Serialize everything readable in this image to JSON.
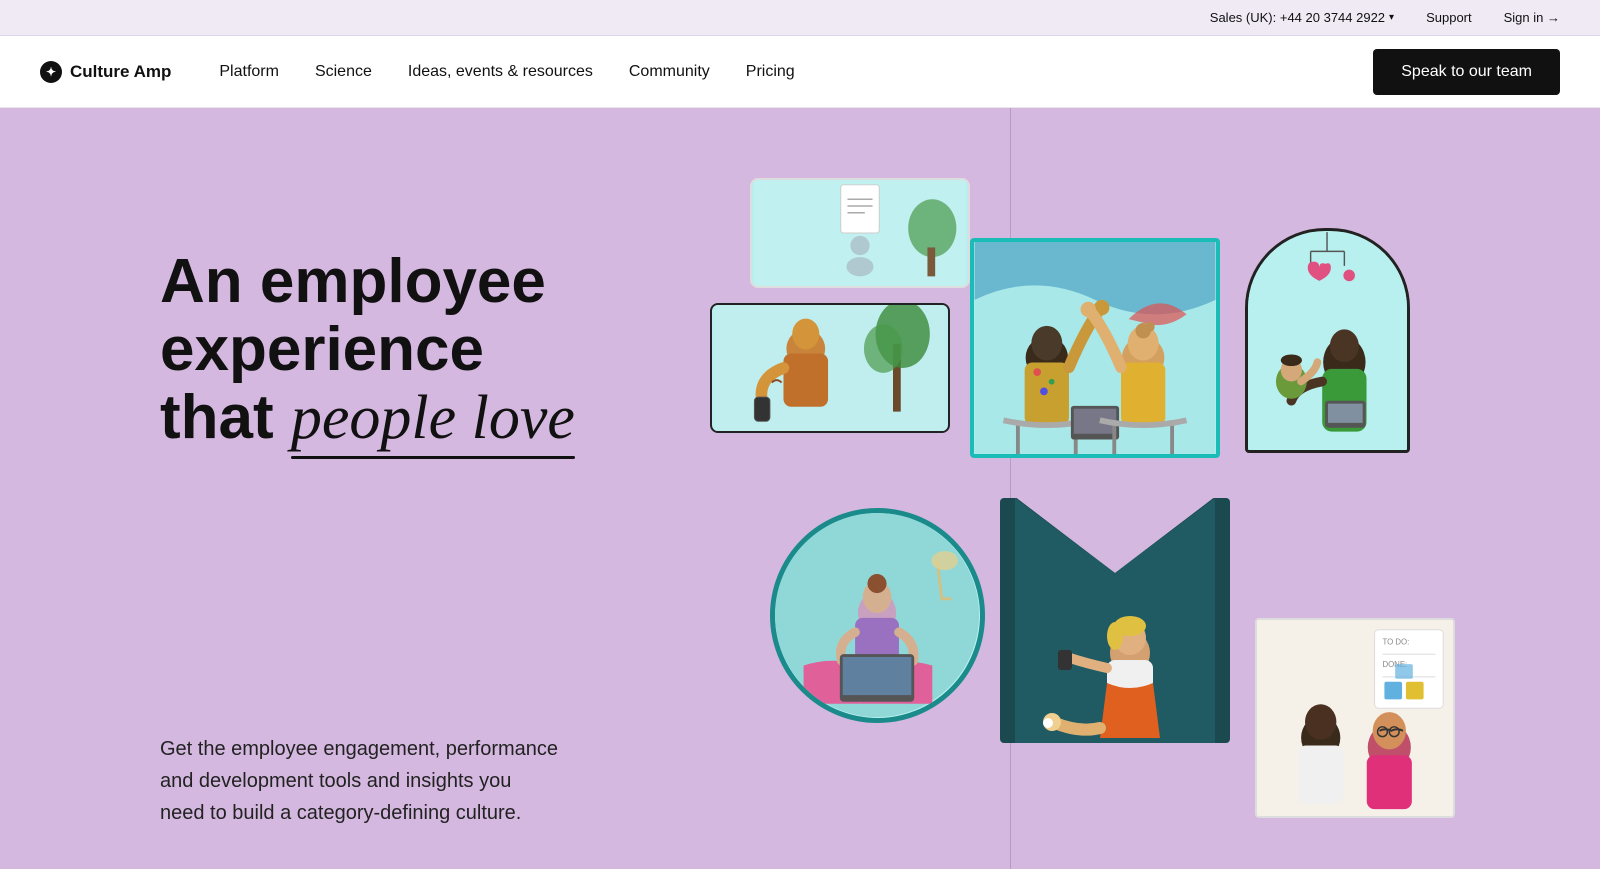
{
  "util_bar": {
    "sales_label": "Sales (UK): +44 20 3744 2922",
    "support_label": "Support",
    "signin_label": "Sign in →"
  },
  "nav": {
    "logo_text": "Culture Amp",
    "logo_icon": "C",
    "links": [
      {
        "label": "Platform",
        "id": "platform"
      },
      {
        "label": "Science",
        "id": "science"
      },
      {
        "label": "Ideas, events & resources",
        "id": "ideas"
      },
      {
        "label": "Community",
        "id": "community"
      },
      {
        "label": "Pricing",
        "id": "pricing"
      }
    ],
    "cta_label": "Speak to our team"
  },
  "hero": {
    "title_line1": "An employee",
    "title_line2": "experience",
    "title_line3": "that ",
    "title_italic": "people love",
    "description": "Get the employee engagement, performance and development tools and insights you need to build a category-defining culture."
  }
}
